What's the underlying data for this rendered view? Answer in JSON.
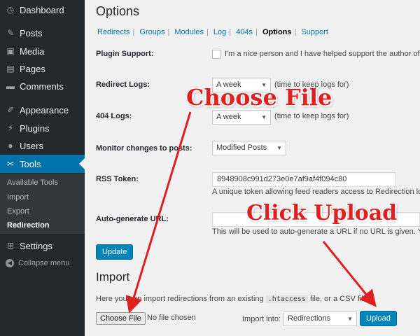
{
  "sidebar": {
    "items": [
      {
        "label": "Dashboard",
        "icon": "dashboard-icon"
      },
      {
        "label": "Posts",
        "icon": "pin-icon"
      },
      {
        "label": "Media",
        "icon": "media-icon"
      },
      {
        "label": "Pages",
        "icon": "pages-icon"
      },
      {
        "label": "Comments",
        "icon": "comment-icon"
      },
      {
        "label": "Appearance",
        "icon": "paintbrush-icon"
      },
      {
        "label": "Plugins",
        "icon": "plugin-icon"
      },
      {
        "label": "Users",
        "icon": "users-icon"
      },
      {
        "label": "Tools",
        "icon": "wrench-icon"
      },
      {
        "label": "Settings",
        "icon": "settings-icon"
      }
    ],
    "submenu": [
      "Available Tools",
      "Import",
      "Export",
      "Redirection"
    ],
    "collapse": "Collapse menu"
  },
  "page": {
    "title": "Options",
    "tabs": [
      "Redirects",
      "Groups",
      "Modules",
      "Log",
      "404s",
      "Options",
      "Support"
    ],
    "current_tab": "Options"
  },
  "options": {
    "plugin_support_label": "Plugin Support:",
    "plugin_support_text": "I'm a nice person and I have helped support the author of",
    "redirect_logs_label": "Redirect Logs:",
    "redirect_logs_value": "A week",
    "redirect_logs_hint": "(time to keep logs for)",
    "logs404_label": "404 Logs:",
    "logs404_value": "A week",
    "logs404_hint": "(time to keep logs for)",
    "monitor_label": "Monitor changes to posts:",
    "monitor_value": "Modified Posts",
    "rss_label": "RSS Token:",
    "rss_value": "8948908c991d273e0e7af9af4f094c80",
    "rss_hint": "A unique token allowing feed readers access to Redirection lo",
    "autogen_label": "Auto-generate URL:",
    "autogen_value": "",
    "autogen_hint": "This will be used to auto-generate a URL if no URL is given. Yo",
    "update_button": "Update"
  },
  "import": {
    "title": "Import",
    "desc_pre": "Here you can import redirections from an existing",
    "desc_code": ".htaccess",
    "desc_post": "file, or a CSV file.",
    "choose_file": "Choose File",
    "no_file": "No file chosen",
    "import_into_label": "Import into:",
    "import_into_value": "Redirections",
    "upload_button": "Upload"
  },
  "annotations": {
    "choose_file": "Choose File",
    "click_upload": "Click Upload",
    "color": "#e02020"
  },
  "colors": {
    "sidebar": "#23282d",
    "active": "#0073aa",
    "primary_button": "#0085ba",
    "link": "#0073aa"
  }
}
